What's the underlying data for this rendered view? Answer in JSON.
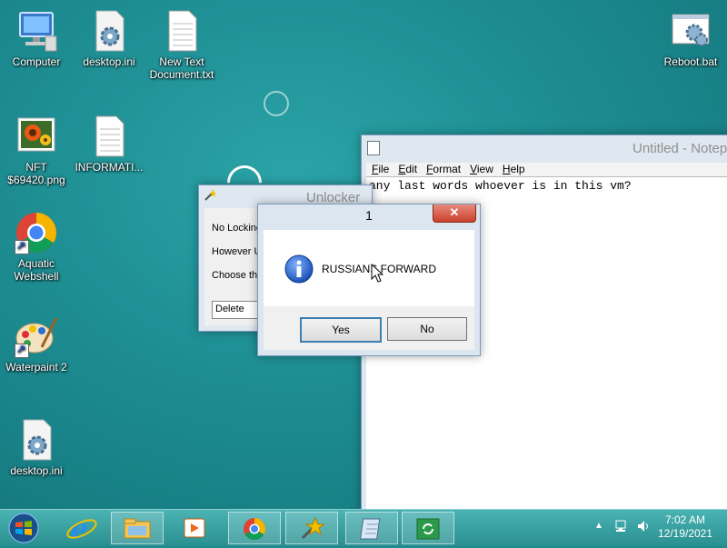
{
  "desktop": {
    "icons": [
      {
        "label": "Computer",
        "icon": "computer-icon"
      },
      {
        "label": "desktop.ini",
        "icon": "settings-file-icon"
      },
      {
        "label": "New Text Document.txt",
        "icon": "text-file-icon"
      },
      {
        "label": "Reboot.bat",
        "icon": "batch-file-icon"
      },
      {
        "label": "NFT $69420.png",
        "icon": "image-file-icon"
      },
      {
        "label": "INFORMATI...",
        "icon": "text-file-icon"
      },
      {
        "label": "Aquatic Webshell",
        "icon": "chrome-icon"
      },
      {
        "label": "Waterpaint 2",
        "icon": "paint-icon"
      },
      {
        "label": "desktop.ini",
        "icon": "settings-file-icon"
      }
    ]
  },
  "notepad": {
    "title": "Untitled - Notep",
    "menu": [
      "File",
      "Edit",
      "Format",
      "View",
      "Help"
    ],
    "text": "any last words whoever is in this vm?"
  },
  "unlocker": {
    "title": "Unlocker",
    "lines": [
      "No Locking",
      "However U",
      "Choose th"
    ],
    "select_value": "Delete"
  },
  "dialog": {
    "title": "1",
    "message": "RUSSIANS FORWARD",
    "close_label": "✕",
    "yes_label": "Yes",
    "no_label": "No"
  },
  "taskbar": {
    "apps": [
      "start-icon",
      "internet-explorer-icon",
      "file-explorer-icon",
      "media-player-icon",
      "chrome-icon",
      "unlocker-icon",
      "notepad-icon",
      "refresh-icon"
    ],
    "time": "7:02 AM",
    "date": "12/19/2021"
  },
  "colors": {
    "desktop": "#1c8a8f",
    "taskbar": "#3aa3a4",
    "close_button": "#c9412b"
  }
}
